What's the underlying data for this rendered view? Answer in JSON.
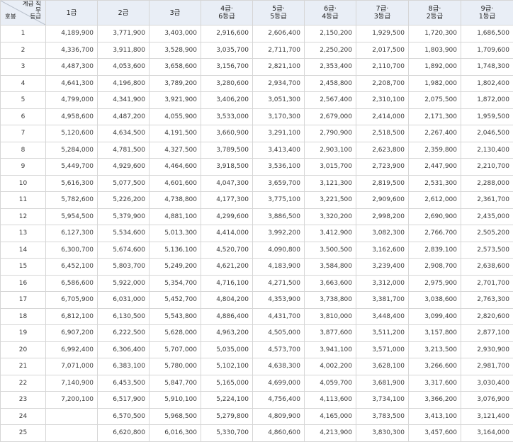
{
  "header": {
    "corner_top": "계급 직무\n등급",
    "corner_bottom": "호봉",
    "columns": [
      "1급",
      "2급",
      "3급",
      "4급·\n6등급",
      "5급·\n5등급",
      "6급·\n4등급",
      "7급·\n3등급",
      "8급·\n2등급",
      "9급·\n1등급"
    ]
  },
  "rows": [
    {
      "hobong": "1",
      "values": [
        "4,189,900",
        "3,771,900",
        "3,403,000",
        "2,916,600",
        "2,606,400",
        "2,150,200",
        "1,929,500",
        "1,720,300",
        "1,686,500"
      ]
    },
    {
      "hobong": "2",
      "values": [
        "4,336,700",
        "3,911,800",
        "3,528,900",
        "3,035,700",
        "2,711,700",
        "2,250,200",
        "2,017,500",
        "1,803,900",
        "1,709,600"
      ]
    },
    {
      "hobong": "3",
      "values": [
        "4,487,300",
        "4,053,600",
        "3,658,600",
        "3,156,700",
        "2,821,100",
        "2,353,400",
        "2,110,700",
        "1,892,000",
        "1,748,300"
      ]
    },
    {
      "hobong": "4",
      "values": [
        "4,641,300",
        "4,196,800",
        "3,789,200",
        "3,280,600",
        "2,934,700",
        "2,458,800",
        "2,208,700",
        "1,982,000",
        "1,802,400"
      ]
    },
    {
      "hobong": "5",
      "values": [
        "4,799,000",
        "4,341,900",
        "3,921,900",
        "3,406,200",
        "3,051,300",
        "2,567,400",
        "2,310,100",
        "2,075,500",
        "1,872,000"
      ]
    },
    {
      "hobong": "6",
      "values": [
        "4,958,600",
        "4,487,200",
        "4,055,900",
        "3,533,000",
        "3,170,300",
        "2,679,000",
        "2,414,000",
        "2,171,300",
        "1,959,500"
      ]
    },
    {
      "hobong": "7",
      "values": [
        "5,120,600",
        "4,634,500",
        "4,191,500",
        "3,660,900",
        "3,291,100",
        "2,790,900",
        "2,518,500",
        "2,267,400",
        "2,046,500"
      ]
    },
    {
      "hobong": "8",
      "values": [
        "5,284,000",
        "4,781,500",
        "4,327,500",
        "3,789,500",
        "3,413,400",
        "2,903,100",
        "2,623,800",
        "2,359,800",
        "2,130,400"
      ]
    },
    {
      "hobong": "9",
      "values": [
        "5,449,700",
        "4,929,600",
        "4,464,600",
        "3,918,500",
        "3,536,100",
        "3,015,700",
        "2,723,900",
        "2,447,900",
        "2,210,700"
      ]
    },
    {
      "hobong": "10",
      "values": [
        "5,616,300",
        "5,077,500",
        "4,601,600",
        "4,047,300",
        "3,659,700",
        "3,121,300",
        "2,819,500",
        "2,531,300",
        "2,288,000"
      ]
    },
    {
      "hobong": "11",
      "values": [
        "5,782,600",
        "5,226,200",
        "4,738,800",
        "4,177,300",
        "3,775,100",
        "3,221,500",
        "2,909,600",
        "2,612,000",
        "2,361,700"
      ]
    },
    {
      "hobong": "12",
      "values": [
        "5,954,500",
        "5,379,900",
        "4,881,100",
        "4,299,600",
        "3,886,500",
        "3,320,200",
        "2,998,200",
        "2,690,900",
        "2,435,000"
      ]
    },
    {
      "hobong": "13",
      "values": [
        "6,127,300",
        "5,534,600",
        "5,013,300",
        "4,414,000",
        "3,992,200",
        "3,412,900",
        "3,082,300",
        "2,766,700",
        "2,505,200"
      ]
    },
    {
      "hobong": "14",
      "values": [
        "6,300,700",
        "5,674,600",
        "5,136,100",
        "4,520,700",
        "4,090,800",
        "3,500,500",
        "3,162,600",
        "2,839,100",
        "2,573,500"
      ]
    },
    {
      "hobong": "15",
      "values": [
        "6,452,100",
        "5,803,700",
        "5,249,200",
        "4,621,200",
        "4,183,900",
        "3,584,800",
        "3,239,400",
        "2,908,700",
        "2,638,600"
      ]
    },
    {
      "hobong": "16",
      "values": [
        "6,586,600",
        "5,922,000",
        "5,354,700",
        "4,716,100",
        "4,271,500",
        "3,663,600",
        "3,312,000",
        "2,975,900",
        "2,701,700"
      ]
    },
    {
      "hobong": "17",
      "values": [
        "6,705,900",
        "6,031,000",
        "5,452,700",
        "4,804,200",
        "4,353,900",
        "3,738,800",
        "3,381,700",
        "3,038,600",
        "2,763,300"
      ]
    },
    {
      "hobong": "18",
      "values": [
        "6,812,100",
        "6,130,500",
        "5,543,800",
        "4,886,400",
        "4,431,700",
        "3,810,000",
        "3,448,400",
        "3,099,400",
        "2,820,600"
      ]
    },
    {
      "hobong": "19",
      "values": [
        "6,907,200",
        "6,222,500",
        "5,628,000",
        "4,963,200",
        "4,505,000",
        "3,877,600",
        "3,511,200",
        "3,157,800",
        "2,877,100"
      ]
    },
    {
      "hobong": "20",
      "values": [
        "6,992,400",
        "6,306,400",
        "5,707,000",
        "5,035,000",
        "4,573,700",
        "3,941,100",
        "3,571,000",
        "3,213,500",
        "2,930,900"
      ]
    },
    {
      "hobong": "21",
      "values": [
        "7,071,000",
        "6,383,100",
        "5,780,000",
        "5,102,100",
        "4,638,300",
        "4,002,200",
        "3,628,100",
        "3,266,600",
        "2,981,700"
      ]
    },
    {
      "hobong": "22",
      "values": [
        "7,140,900",
        "6,453,500",
        "5,847,700",
        "5,165,000",
        "4,699,000",
        "4,059,700",
        "3,681,900",
        "3,317,600",
        "3,030,400"
      ]
    },
    {
      "hobong": "23",
      "values": [
        "7,200,100",
        "6,517,900",
        "5,910,100",
        "5,224,100",
        "4,756,400",
        "4,113,600",
        "3,734,100",
        "3,366,200",
        "3,076,900"
      ]
    },
    {
      "hobong": "24",
      "values": [
        "",
        "6,570,500",
        "5,968,500",
        "5,279,800",
        "4,809,900",
        "4,165,000",
        "3,783,500",
        "3,413,100",
        "3,121,400"
      ]
    },
    {
      "hobong": "25",
      "values": [
        "",
        "6,620,800",
        "6,016,300",
        "5,330,700",
        "4,860,600",
        "4,213,900",
        "3,830,300",
        "3,457,600",
        "3,164,000"
      ]
    }
  ]
}
